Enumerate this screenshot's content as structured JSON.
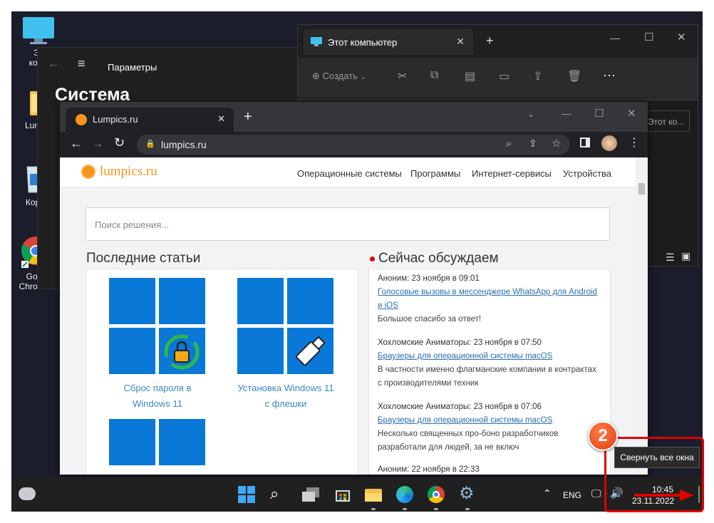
{
  "desktop": {
    "icons": [
      {
        "label": "Эт",
        "label2": "комп"
      },
      {
        "label": "Lump"
      },
      {
        "label": "Кор"
      },
      {
        "label": "Goo",
        "label2": "Chrome"
      }
    ]
  },
  "settings": {
    "title": "Параметры",
    "heading": "Система"
  },
  "explorer": {
    "tab_title": "Этот компьютер",
    "create_label": "Создать",
    "search_placeholder": "Этот ко..."
  },
  "browser": {
    "tab_title": "Lumpics.ru",
    "url": "lumpics.ru"
  },
  "site": {
    "logo": "lumpics.ru",
    "nav": [
      "Операционные системы",
      "Программы",
      "Интернет-сервисы",
      "Устройства"
    ],
    "search_placeholder": "Поиск решения...",
    "latest_heading": "Последние статьи",
    "discuss_heading": "Сейчас обсуждаем",
    "articles": [
      {
        "line1": "Сброс пароля в",
        "line2": "Windows 11"
      },
      {
        "line1": "Установка Windows 11",
        "line2": "с флешки"
      }
    ],
    "comments": [
      {
        "who": "Аноним: 23 ноября в 09:01",
        "link1": "Голосовые вызовы в мессенджере WhatsApp для Android",
        "link2": "и iOS",
        "text1": "Большое спасибо за ответ!",
        "text2": ""
      },
      {
        "who": "Хохломские Аниматоры: 23 ноября в 07:50",
        "link1": "Браузеры для операционной системы macOS",
        "link2": "",
        "text1": "В частности именно флагманские компании в контрактах",
        "text2": "с производителями техник"
      },
      {
        "who": "Хохломские Аниматоры: 23 ноября в 07:06",
        "link1": "Браузеры для операционной системы macOS",
        "link2": "",
        "text1": "Несколько священных про-боно разработчиков",
        "text2": "разработали для людей, за не включ"
      },
      {
        "who": "Аноним: 22 ноября в 22:33",
        "link1": "",
        "link2": "",
        "text1": "",
        "text2": ""
      }
    ]
  },
  "taskbar": {
    "lang": "ENG",
    "time": "10:45",
    "date": "23.11.2022",
    "tooltip": "Свернуть все окна"
  },
  "annotation": {
    "badge": "2",
    "accent": "#e10000"
  }
}
